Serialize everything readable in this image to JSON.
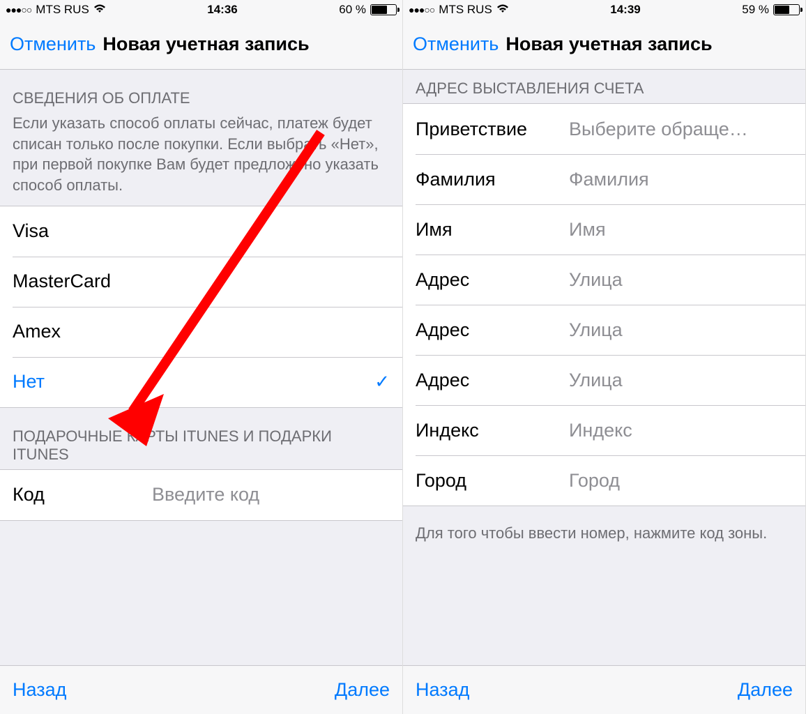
{
  "left": {
    "status": {
      "carrier": "MTS RUS",
      "time": "14:36",
      "battery_pct": "60 %",
      "battery_fill": 60
    },
    "nav": {
      "cancel": "Отменить",
      "title": "Новая учетная запись"
    },
    "payment": {
      "header": "СВЕДЕНИЯ ОБ ОПЛАТЕ",
      "desc": "Если указать способ оплаты сейчас, платеж будет списан только после покупки. Если выбрать «Нет», при первой покупке Вам будет предложено указать способ оплаты.",
      "options": [
        {
          "label": "Visa",
          "selected": false
        },
        {
          "label": "MasterCard",
          "selected": false
        },
        {
          "label": "Amex",
          "selected": false
        },
        {
          "label": "Нет",
          "selected": true
        }
      ]
    },
    "gift": {
      "header": "ПОДАРОЧНЫЕ КАРТЫ ITUNES И ПОДАРКИ ITUNES",
      "code_label": "Код",
      "code_placeholder": "Введите код"
    },
    "toolbar": {
      "back": "Назад",
      "next": "Далее"
    }
  },
  "right": {
    "status": {
      "carrier": "MTS RUS",
      "time": "14:39",
      "battery_pct": "59 %",
      "battery_fill": 59
    },
    "nav": {
      "cancel": "Отменить",
      "title": "Новая учетная запись"
    },
    "billing": {
      "header": "АДРЕС ВЫСТАВЛЕНИЯ СЧЕТА",
      "fields": [
        {
          "label": "Приветствие",
          "placeholder": "Выберите обраще…"
        },
        {
          "label": "Фамилия",
          "placeholder": "Фамилия"
        },
        {
          "label": "Имя",
          "placeholder": "Имя"
        },
        {
          "label": "Адрес",
          "placeholder": "Улица"
        },
        {
          "label": "Адрес",
          "placeholder": "Улица"
        },
        {
          "label": "Адрес",
          "placeholder": "Улица"
        },
        {
          "label": "Индекс",
          "placeholder": "Индекс"
        },
        {
          "label": "Город",
          "placeholder": "Город"
        }
      ],
      "footer": "Для того чтобы ввести номер, нажмите код зоны."
    },
    "toolbar": {
      "back": "Назад",
      "next": "Далее"
    }
  }
}
